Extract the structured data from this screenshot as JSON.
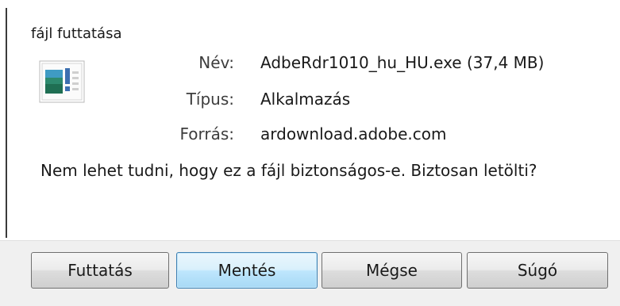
{
  "dialog": {
    "title": "fájl futtatása"
  },
  "file_info": {
    "icon": "executable-file-icon",
    "name_label": "Név:",
    "name_value": "AdbeRdr1010_hu_HU.exe (37,4 MB)",
    "type_label": "Típus:",
    "type_value": "Alkalmazás",
    "source_label": "Forrás:",
    "source_value": "ardownload.adobe.com"
  },
  "warning_text": "Nem lehet tudni, hogy ez a fájl biztonságos-e. Biztosan letölti?",
  "buttons": {
    "run": "Futtatás",
    "save": "Mentés",
    "cancel": "Mégse",
    "help": "Súgó"
  },
  "colors": {
    "default_button_border": "#3c7fb1",
    "button_bar_bg": "#f0f0f0"
  }
}
